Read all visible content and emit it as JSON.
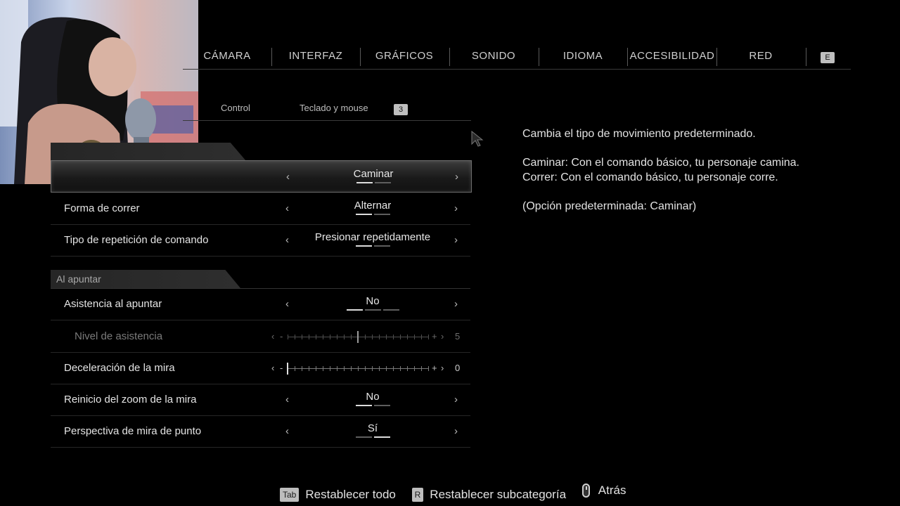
{
  "top_tabs": [
    {
      "label": "CÁMARA"
    },
    {
      "label": "INTERFAZ"
    },
    {
      "label": "GRÁFICOS"
    },
    {
      "label": "SONIDO"
    },
    {
      "label": "IDIOMA"
    },
    {
      "label": "ACCESIBILIDAD"
    },
    {
      "label": "RED"
    }
  ],
  "top_tab_next_key": "E",
  "sub_tabs": [
    {
      "label": "Control"
    },
    {
      "label": "Teclado y mouse"
    }
  ],
  "sub_tab_next_key": "3",
  "settings": {
    "row_movement": {
      "value": "Caminar",
      "steps": 2,
      "selected_step": 0
    },
    "row_run": {
      "label": "Forma de correr",
      "value": "Alternar",
      "steps": 2,
      "selected_step": 0
    },
    "row_repeat": {
      "label": "Tipo de repetición de comando",
      "value": "Presionar repetidamente",
      "steps": 2,
      "selected_step": 0
    },
    "section_aim": {
      "label": "Al apuntar"
    },
    "row_aim_assist": {
      "label": "Asistencia al apuntar",
      "value": "No",
      "steps": 3,
      "selected_step": 0
    },
    "row_assist_level": {
      "label": "Nivel de asistencia",
      "value": "5",
      "min": 0,
      "max": 10
    },
    "row_decel": {
      "label": "Deceleración de la mira",
      "value": "0",
      "min": 0,
      "max": 10
    },
    "row_zoom_reset": {
      "label": "Reinicio del zoom de la mira",
      "value": "No",
      "steps": 2,
      "selected_step": 0
    },
    "row_dot_sight": {
      "label": "Perspectiva de mira de punto",
      "value": "Sí",
      "steps": 2,
      "selected_step": 1
    }
  },
  "description": {
    "line1": "Cambia el tipo de movimiento predeterminado.",
    "line2": "Caminar: Con el comando básico, tu personaje camina.",
    "line3": "Correr: Con el comando básico, tu personaje corre.",
    "line4": "(Opción predeterminada: Caminar)"
  },
  "footer": {
    "reset_all_key": "Tab",
    "reset_all_label": "Restablecer todo",
    "reset_sub_key": "R",
    "reset_sub_label": "Restablecer subcategoría",
    "back_label": "Atrás"
  },
  "glyphs": {
    "left": "‹",
    "right": "›",
    "minus": "-",
    "plus": "+"
  },
  "colors": {
    "background": "#000000",
    "selected_row": "#3b3b3b",
    "text": "#e4e4e4"
  }
}
